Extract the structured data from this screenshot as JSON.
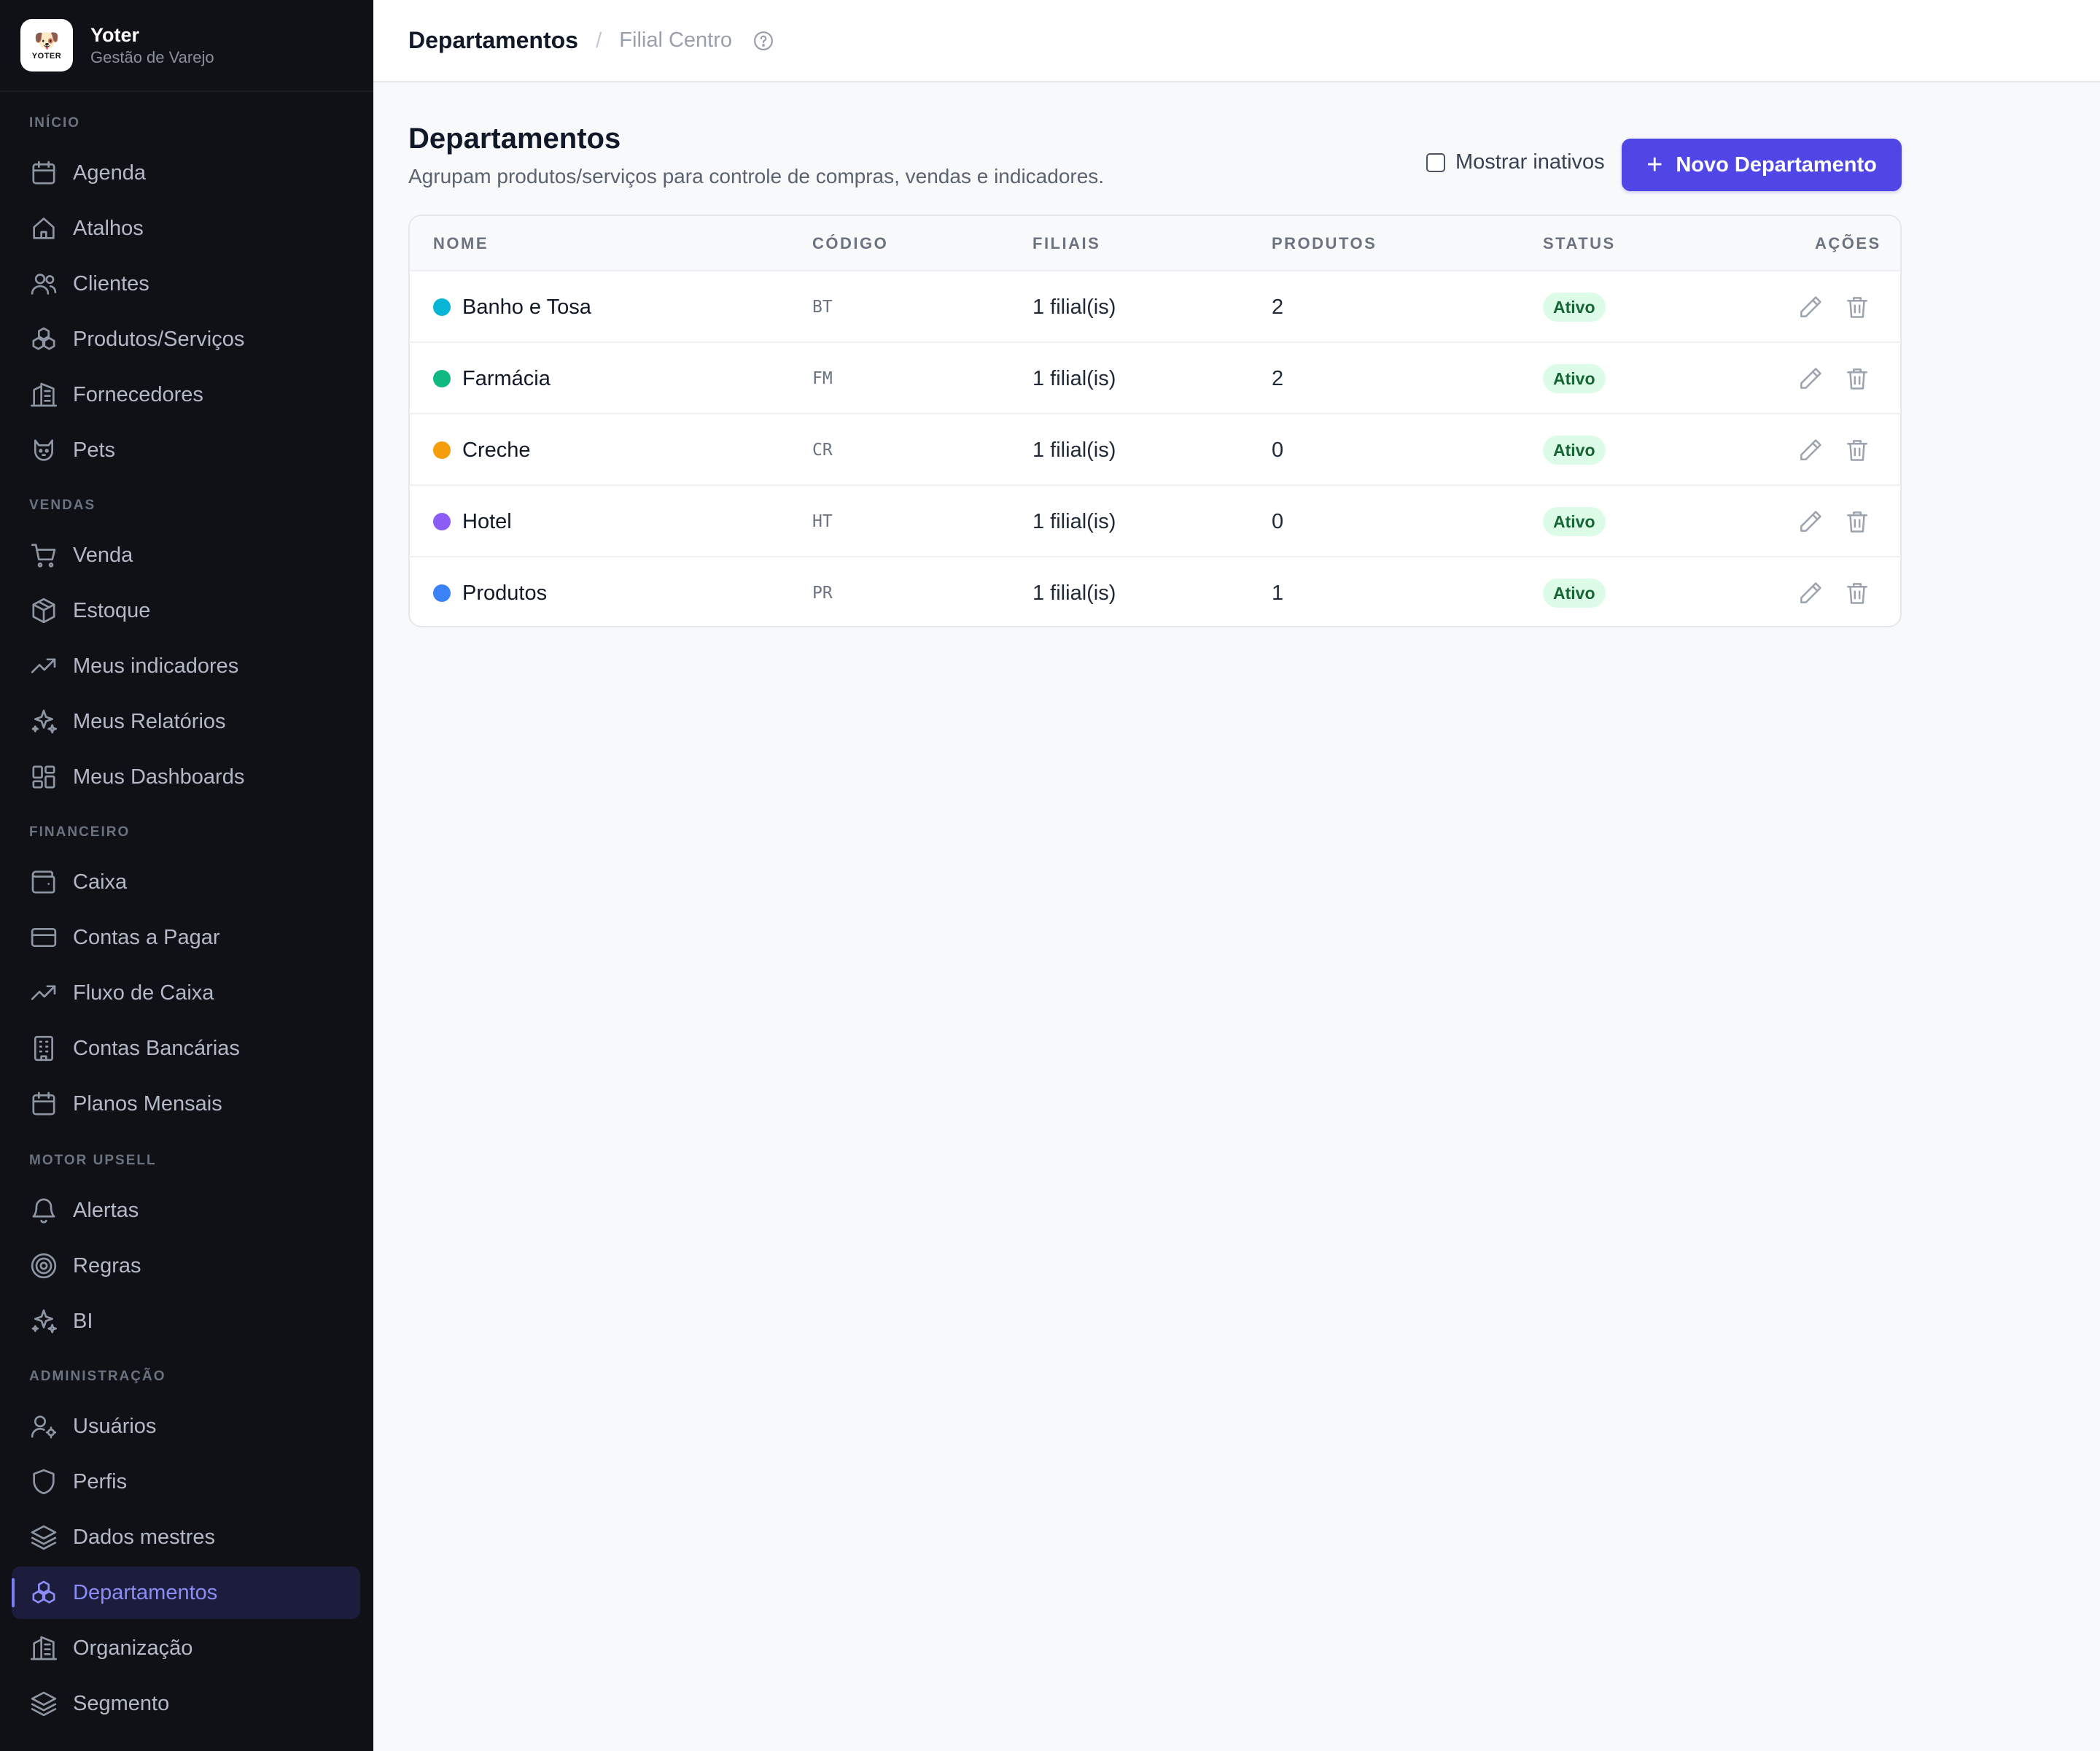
{
  "brand": {
    "name": "Yoter",
    "subtitle": "Gestão de Varejo",
    "logo_text": "YOTER"
  },
  "sidebar": {
    "sections": [
      {
        "title": "INÍCIO",
        "items": [
          {
            "label": "Agenda",
            "icon": "calendar-icon"
          },
          {
            "label": "Atalhos",
            "icon": "home-icon"
          },
          {
            "label": "Clientes",
            "icon": "users-icon"
          },
          {
            "label": "Produtos/Serviços",
            "icon": "boxes-icon"
          },
          {
            "label": "Fornecedores",
            "icon": "building-icon"
          },
          {
            "label": "Pets",
            "icon": "cat-icon"
          }
        ]
      },
      {
        "title": "VENDAS",
        "items": [
          {
            "label": "Venda",
            "icon": "cart-icon"
          },
          {
            "label": "Estoque",
            "icon": "package-icon"
          },
          {
            "label": "Meus indicadores",
            "icon": "trending-up-icon"
          },
          {
            "label": "Meus Relatórios",
            "icon": "sparkles-icon"
          },
          {
            "label": "Meus Dashboards",
            "icon": "dashboard-icon"
          }
        ]
      },
      {
        "title": "FINANCEIRO",
        "items": [
          {
            "label": "Caixa",
            "icon": "wallet-icon"
          },
          {
            "label": "Contas a Pagar",
            "icon": "credit-card-icon"
          },
          {
            "label": "Fluxo de Caixa",
            "icon": "trending-up-icon"
          },
          {
            "label": "Contas Bancárias",
            "icon": "bank-building-icon"
          },
          {
            "label": "Planos Mensais",
            "icon": "calendar-icon"
          }
        ]
      },
      {
        "title": "MOTOR UPSELL",
        "items": [
          {
            "label": "Alertas",
            "icon": "bell-icon"
          },
          {
            "label": "Regras",
            "icon": "target-icon"
          },
          {
            "label": "BI",
            "icon": "sparkles-icon"
          }
        ]
      },
      {
        "title": "ADMINISTRAÇÃO",
        "items": [
          {
            "label": "Usuários",
            "icon": "user-gear-icon"
          },
          {
            "label": "Perfis",
            "icon": "shield-icon"
          },
          {
            "label": "Dados mestres",
            "icon": "layers-icon"
          },
          {
            "label": "Departamentos",
            "icon": "boxes-icon",
            "active": true
          },
          {
            "label": "Organização",
            "icon": "building-icon"
          },
          {
            "label": "Segmento",
            "icon": "layers-icon"
          }
        ]
      }
    ]
  },
  "topbar": {
    "title": "Departamentos",
    "separator": "/",
    "branch": "Filial Centro"
  },
  "page": {
    "title": "Departamentos",
    "subtitle": "Agrupam produtos/serviços para controle de compras, vendas e indicadores.",
    "show_inactive_label": "Mostrar inativos",
    "new_button_label": "Novo Departamento",
    "new_button_icon": "+"
  },
  "table": {
    "headers": {
      "name": "NOME",
      "code": "CÓDIGO",
      "branches": "FILIAIS",
      "products": "PRODUTOS",
      "status": "STATUS",
      "actions": "AÇÕES"
    },
    "rows": [
      {
        "name": "Banho e Tosa",
        "color": "#06b6d4",
        "code": "BT",
        "branches": "1 filial(is)",
        "products": "2",
        "status": "Ativo"
      },
      {
        "name": "Farmácia",
        "color": "#10b981",
        "code": "FM",
        "branches": "1 filial(is)",
        "products": "2",
        "status": "Ativo"
      },
      {
        "name": "Creche",
        "color": "#f59e0b",
        "code": "CR",
        "branches": "1 filial(is)",
        "products": "0",
        "status": "Ativo"
      },
      {
        "name": "Hotel",
        "color": "#8b5cf6",
        "code": "HT",
        "branches": "1 filial(is)",
        "products": "0",
        "status": "Ativo"
      },
      {
        "name": "Produtos",
        "color": "#3b82f6",
        "code": "PR",
        "branches": "1 filial(is)",
        "products": "1",
        "status": "Ativo"
      }
    ]
  },
  "colors": {
    "accent": "#4f46e5",
    "sidebar_bg": "#0f1117",
    "badge_bg": "#dcfce7",
    "badge_text": "#166534"
  }
}
